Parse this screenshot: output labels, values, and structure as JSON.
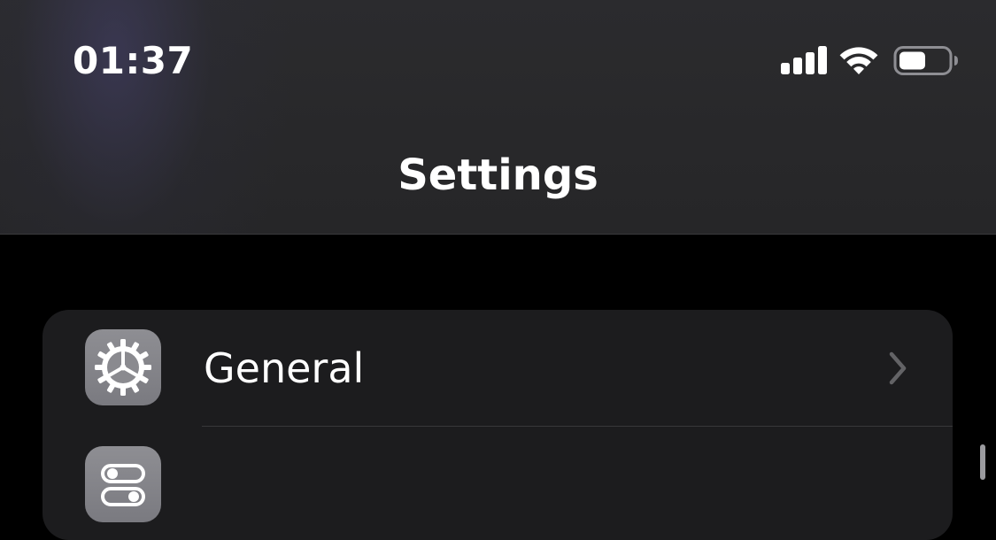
{
  "status_bar": {
    "time": "01:37",
    "signal_icon": "cellular-signal-icon",
    "wifi_icon": "wifi-icon",
    "battery_icon": "battery-icon",
    "battery_level": 0.55
  },
  "nav": {
    "title": "Settings"
  },
  "settings_group": {
    "items": [
      {
        "label": "General",
        "icon": "gear-icon",
        "icon_bg": "#8e8e93"
      },
      {
        "label": "",
        "icon": "control-center-icon",
        "icon_bg": "#8e8e93"
      }
    ]
  },
  "colors": {
    "background": "#000000",
    "header": "#2b2b2e",
    "group_background": "#1c1c1e",
    "chevron": "#636366",
    "separator": "#38383a"
  }
}
